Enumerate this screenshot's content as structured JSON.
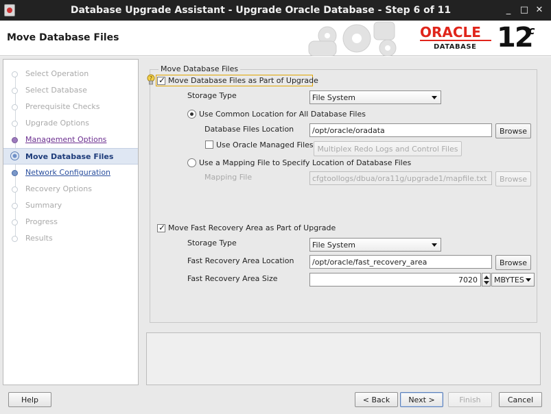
{
  "window": {
    "title": "Database Upgrade Assistant - Upgrade Oracle Database - Step 6 of 11",
    "controls": {
      "minimize": "_",
      "maximize": "□",
      "close": "✕"
    }
  },
  "header": {
    "page_title": "Move Database Files",
    "brand": "ORACLE",
    "product": "DATABASE",
    "version": "12",
    "version_suffix": "c"
  },
  "sidebar": {
    "steps": [
      {
        "label": "Select Operation",
        "state": "disabled"
      },
      {
        "label": "Select Database",
        "state": "disabled"
      },
      {
        "label": "Prerequisite Checks",
        "state": "disabled"
      },
      {
        "label": "Upgrade Options",
        "state": "disabled"
      },
      {
        "label": "Management Options",
        "state": "visited"
      },
      {
        "label": "Move Database Files",
        "state": "current"
      },
      {
        "label": "Network Configuration",
        "state": "enabled"
      },
      {
        "label": "Recovery Options",
        "state": "disabled"
      },
      {
        "label": "Summary",
        "state": "disabled"
      },
      {
        "label": "Progress",
        "state": "disabled"
      },
      {
        "label": "Results",
        "state": "disabled"
      }
    ]
  },
  "form": {
    "group_title": "Move Database Files",
    "move_db_files": {
      "label": "Move Database Files as Part of Upgrade",
      "checked": true
    },
    "storage_type": {
      "label": "Storage Type",
      "value": "File System"
    },
    "common_location": {
      "label": "Use Common Location for All Database Files",
      "selected": true
    },
    "db_files_location": {
      "label": "Database Files Location",
      "value": "/opt/oracle/oradata",
      "browse": "Browse"
    },
    "oracle_managed": {
      "label": "Use Oracle Managed Files",
      "checked": false,
      "multiplex": "Multiplex Redo Logs and Control Files"
    },
    "mapping_file_option": {
      "label": "Use a Mapping File to Specify Location of Database Files",
      "selected": false
    },
    "mapping_file": {
      "label": "Mapping File",
      "value": "cfgtoollogs/dbua/ora11g/upgrade1/mapfile.txt",
      "browse": "Browse"
    },
    "move_fra": {
      "label": "Move Fast Recovery Area as Part of Upgrade",
      "checked": true
    },
    "fra_storage_type": {
      "label": "Storage Type",
      "value": "File System"
    },
    "fra_location": {
      "label": "Fast Recovery Area Location",
      "value": "/opt/oracle/fast_recovery_area",
      "browse": "Browse"
    },
    "fra_size": {
      "label": "Fast Recovery Area Size",
      "value": "7020",
      "unit": "MBYTES"
    }
  },
  "footer": {
    "help": "Help",
    "back": "< Back",
    "next": "Next >",
    "finish": "Finish",
    "cancel": "Cancel"
  }
}
